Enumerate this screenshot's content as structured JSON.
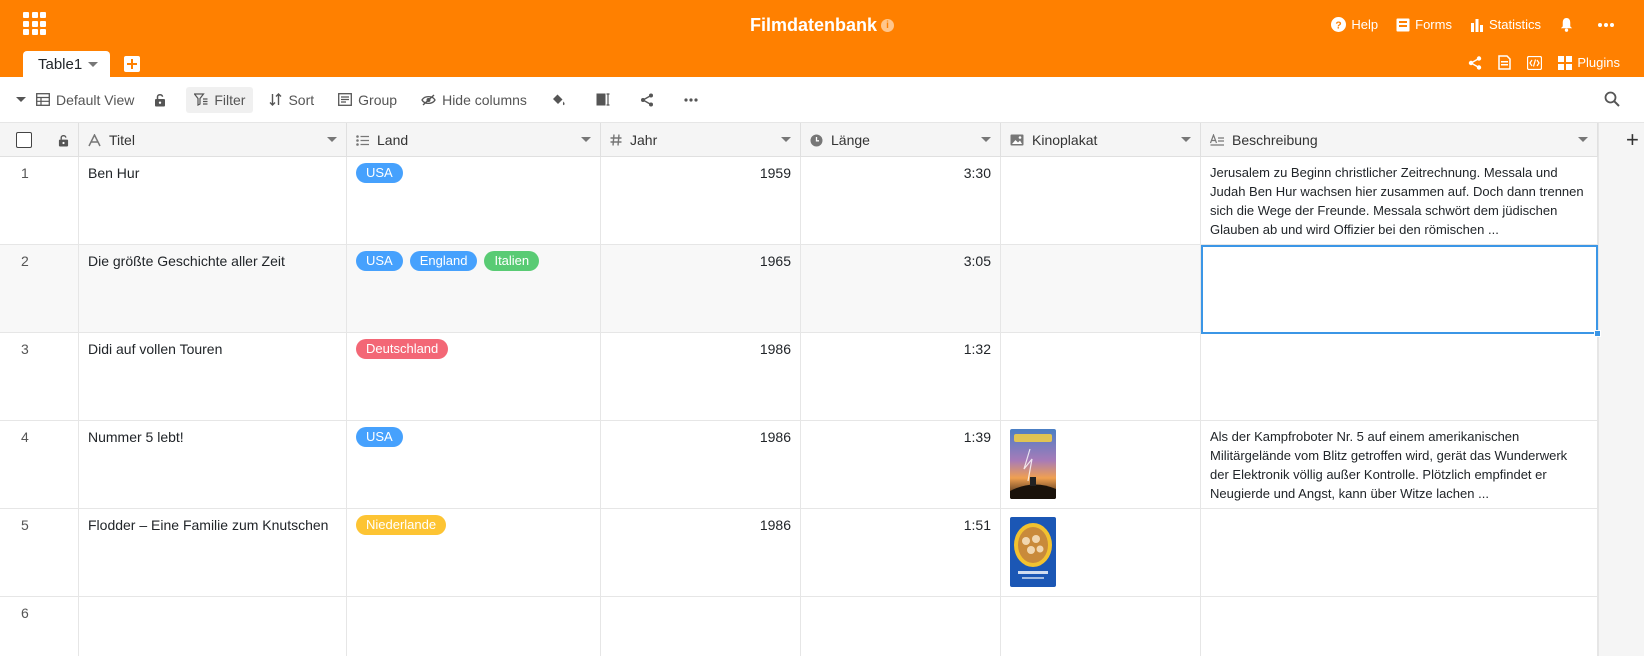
{
  "app": {
    "title": "Filmdatenbank",
    "accent_color": "#ff8000"
  },
  "header_nav": {
    "help": "Help",
    "forms": "Forms",
    "statistics": "Statistics"
  },
  "tabs": [
    {
      "label": "Table1"
    }
  ],
  "tab_toolbar": {
    "plugins": "Plugins"
  },
  "toolbar": {
    "view": "Default View",
    "filter": "Filter",
    "sort": "Sort",
    "group": "Group",
    "hide_columns": "Hide columns"
  },
  "columns": [
    {
      "name": "Titel",
      "icon": "text-icon"
    },
    {
      "name": "Land",
      "icon": "list-icon"
    },
    {
      "name": "Jahr",
      "icon": "hash-icon"
    },
    {
      "name": "Länge",
      "icon": "clock-icon"
    },
    {
      "name": "Kinoplakat",
      "icon": "image-icon"
    },
    {
      "name": "Beschreibung",
      "icon": "longtext-icon"
    }
  ],
  "rows": [
    {
      "index": "1",
      "titel": "Ben Hur",
      "land": [
        {
          "label": "USA",
          "color": "#46a1fd"
        }
      ],
      "jahr": "1959",
      "laenge": "3:30",
      "poster": "",
      "beschreibung": "Jerusalem zu Beginn christlicher Zeitrechnung. Messala und Judah Ben Hur wachsen hier zusammen auf. Doch dann trennen sich die Wege der Freunde. Messala schwört dem jüdischen Glauben ab und wird Offizier bei den römischen ..."
    },
    {
      "index": "2",
      "titel": "Die größte Geschichte aller Zeit",
      "land": [
        {
          "label": "USA",
          "color": "#46a1fd"
        },
        {
          "label": "England",
          "color": "#46a1fd"
        },
        {
          "label": "Italien",
          "color": "#59cb74"
        }
      ],
      "jahr": "1965",
      "laenge": "3:05",
      "poster": "",
      "beschreibung": ""
    },
    {
      "index": "3",
      "titel": "Didi auf vollen Touren",
      "land": [
        {
          "label": "Deutschland",
          "color": "#f36776"
        }
      ],
      "jahr": "1986",
      "laenge": "1:32",
      "poster": "",
      "beschreibung": ""
    },
    {
      "index": "4",
      "titel": "Nummer 5 lebt!",
      "land": [
        {
          "label": "USA",
          "color": "#46a1fd"
        }
      ],
      "jahr": "1986",
      "laenge": "1:39",
      "poster": "sky-poster",
      "beschreibung": "Als der Kampfroboter Nr. 5 auf einem amerikanischen Militärgelände vom Blitz getroffen wird, gerät das Wunderwerk der Elektronik völlig außer Kontrolle. Plötzlich empfindet er Neugierde und Angst, kann über Witze lachen ..."
    },
    {
      "index": "5",
      "titel": "Flodder – Eine Familie zum Knutschen",
      "land": [
        {
          "label": "Niederlande",
          "color": "#fdc433"
        }
      ],
      "jahr": "1986",
      "laenge": "1:51",
      "poster": "blue-poster",
      "beschreibung": ""
    },
    {
      "index": "6",
      "titel": "",
      "land": [],
      "jahr": "",
      "laenge": "",
      "poster": "",
      "beschreibung": ""
    }
  ]
}
